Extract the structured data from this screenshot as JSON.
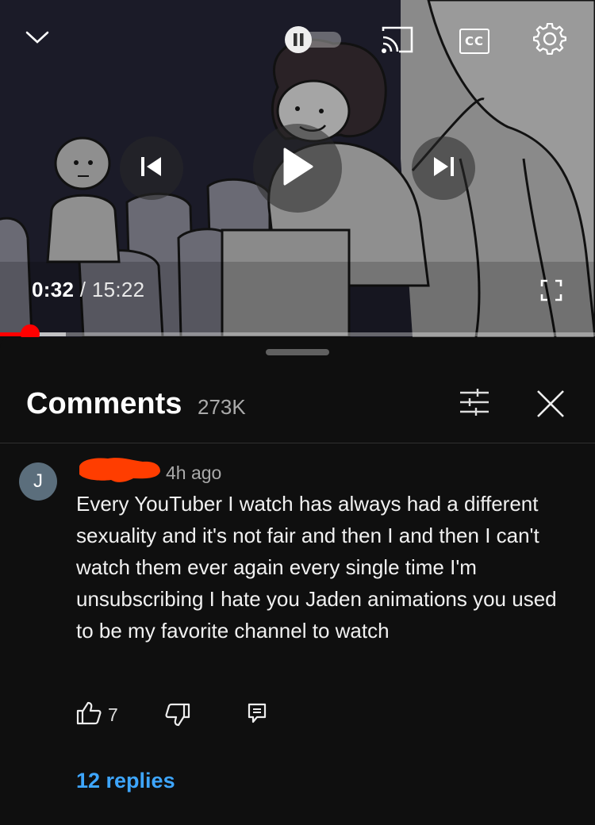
{
  "player": {
    "current_time": "0:32",
    "separator": " / ",
    "duration": "15:22",
    "progress": {
      "played_fraction": 0.05,
      "buffered_fraction": 0.11
    },
    "icons": {
      "minimize": "chevron-down-icon",
      "autoplay": "autoplay-toggle-icon",
      "cast": "cast-icon",
      "captions": "captions-icon",
      "settings": "gear-icon",
      "previous": "skip-previous-icon",
      "play": "play-icon",
      "next": "skip-next-icon",
      "fullscreen": "fullscreen-icon"
    },
    "captions_label": "CC"
  },
  "comments": {
    "title": "Comments",
    "count": "273K",
    "icons": {
      "filter": "filter-sliders-icon",
      "close": "close-icon"
    },
    "items": [
      {
        "avatar_letter": "J",
        "author_redaction_color": "#ff3d00",
        "time": "4h ago",
        "text": "Every YouTuber I watch has always had a different sexuality and it's not fair and then I and then I can't watch them ever again every single time I'm unsubscribing I hate you Jaden animations you used to be my favorite channel to watch",
        "likes": "7",
        "replies_label": "12 replies",
        "icons": {
          "like": "thumbs-up-icon",
          "dislike": "thumbs-down-icon",
          "reply": "reply-icon"
        }
      }
    ]
  },
  "colors": {
    "accent_red": "#ff0000",
    "link_blue": "#3ea6ff",
    "background": "#0f0f0f",
    "avatar": "#5b6e7c"
  }
}
